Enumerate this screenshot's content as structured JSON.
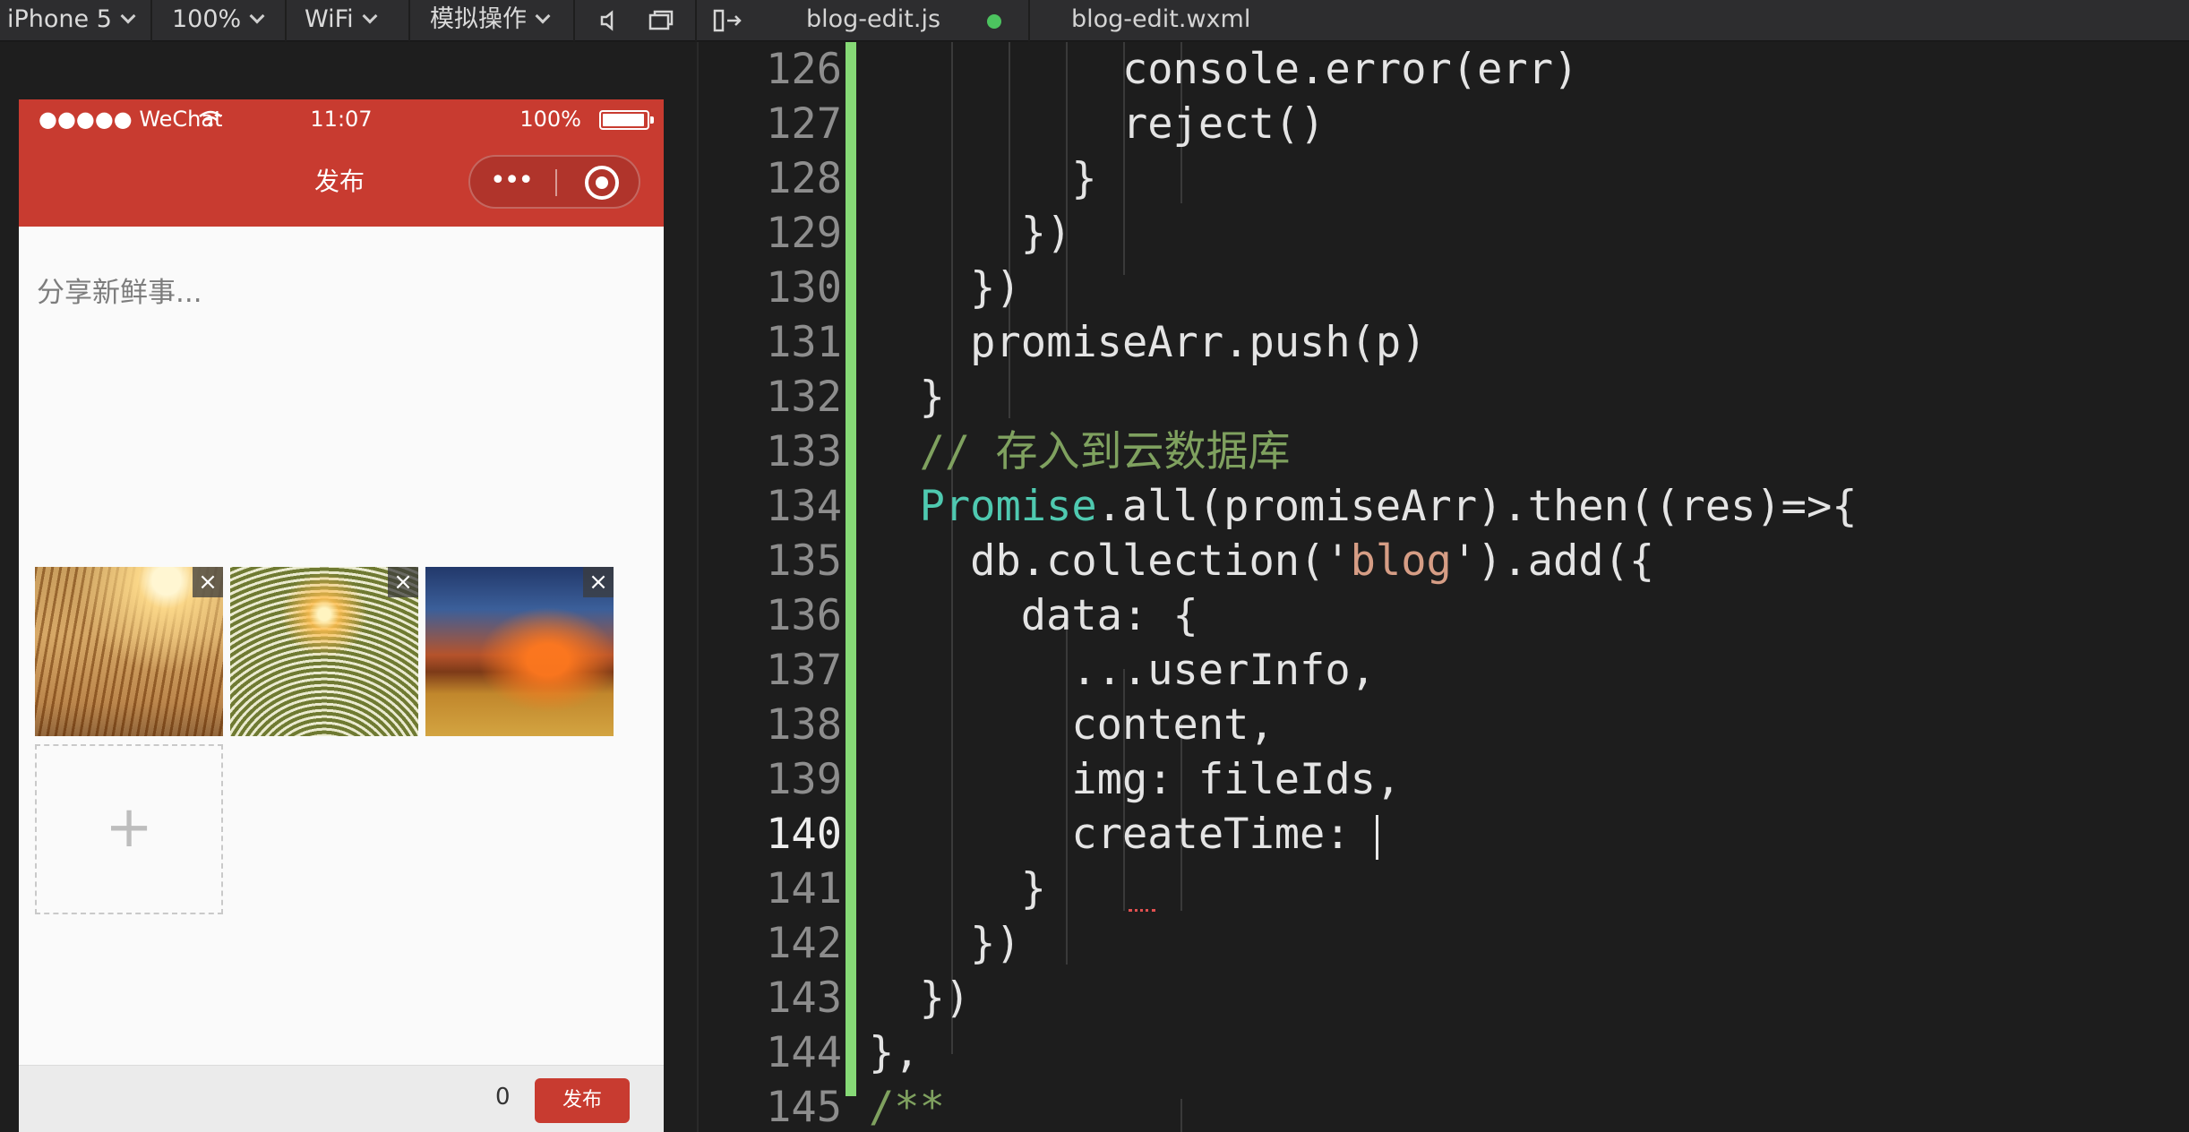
{
  "toolbar": {
    "device": "iPhone 5",
    "zoom": "100%",
    "network": "WiFi",
    "simulate": "模拟操作"
  },
  "tabs": [
    {
      "label": "blog-edit.js",
      "modified": true
    },
    {
      "label": "blog-edit.wxml",
      "modified": false
    }
  ],
  "phone": {
    "status": {
      "signal": "●●●●● WeChat",
      "time": "11:07",
      "battery": "100%"
    },
    "nav_title": "发布",
    "capsule_more": "•••",
    "placeholder": "分享新鲜事...",
    "image_delete": "×",
    "add_icon": "+",
    "word_count": "0",
    "publish_label": "发布"
  },
  "editor": {
    "current_line": "140",
    "lines": [
      {
        "n": "126",
        "code": "          console.error(err)"
      },
      {
        "n": "127",
        "code": "          reject()"
      },
      {
        "n": "128",
        "code": "        }"
      },
      {
        "n": "129",
        "code": "      })"
      },
      {
        "n": "130",
        "code": "    })"
      },
      {
        "n": "131",
        "code": "    promiseArr.push(p)"
      },
      {
        "n": "132",
        "code": "  }"
      },
      {
        "n": "133",
        "code": "  // 存入到云数据库"
      },
      {
        "n": "134",
        "code": "  Promise.all(promiseArr).then((res)=>{"
      },
      {
        "n": "135",
        "code": "    db.collection('blog').add({"
      },
      {
        "n": "136",
        "code": "      data: {"
      },
      {
        "n": "137",
        "code": "        ...userInfo,"
      },
      {
        "n": "138",
        "code": "        content,"
      },
      {
        "n": "139",
        "code": "        img: fileIds,"
      },
      {
        "n": "140",
        "code": "        createTime: "
      },
      {
        "n": "141",
        "code": "      }"
      },
      {
        "n": "142",
        "code": "    })"
      },
      {
        "n": "143",
        "code": "  })"
      },
      {
        "n": "144",
        "code": "},"
      },
      {
        "n": "145",
        "code": "/**"
      }
    ]
  }
}
